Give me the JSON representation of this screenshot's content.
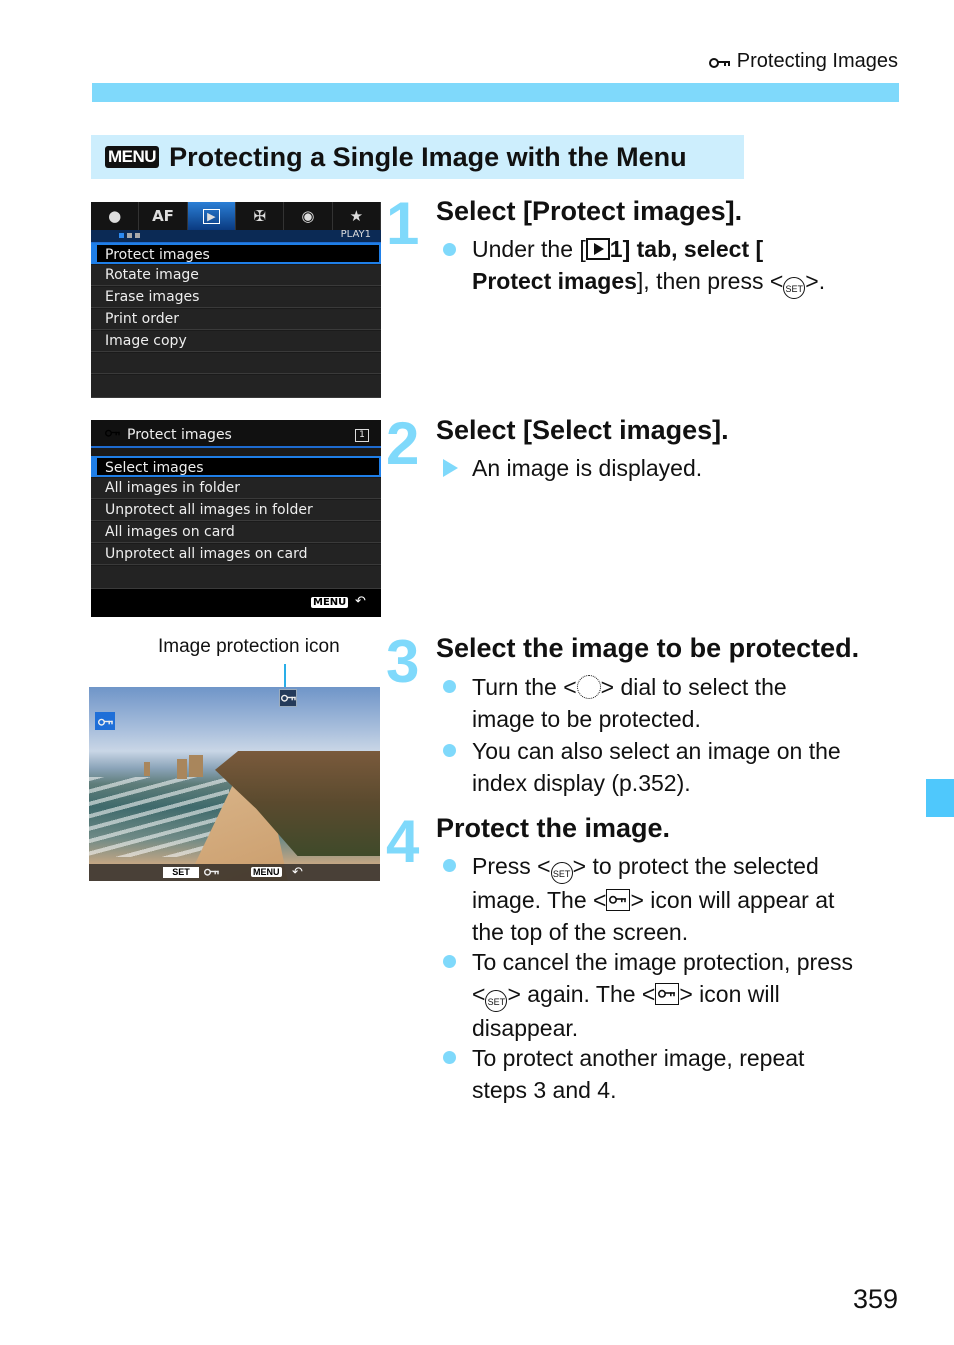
{
  "header": {
    "running_head": "Protecting Images",
    "running_head_icon": "key-icon",
    "accent_color": "#7fd9fb"
  },
  "section": {
    "badge": "MENU",
    "title": "Protecting a Single Image with the Menu"
  },
  "screen1": {
    "tabs": [
      "camera-icon",
      "AF",
      "play-icon",
      "wrench-icon",
      "custom-icon",
      "star-icon"
    ],
    "tab_af_label": "AF",
    "active_tab": "play",
    "page_label": "PLAY1",
    "items": [
      "Protect images",
      "Rotate image",
      "Erase images",
      "Print order",
      "Image copy"
    ],
    "selected_index": 0
  },
  "screen2": {
    "title": "Protect images",
    "card_label": "1",
    "items": [
      "Select images",
      "All images in folder",
      "Unprotect all images in folder",
      "All images on card",
      "Unprotect all images on card"
    ],
    "selected_index": 0,
    "footer_menu": "MENU"
  },
  "screen3": {
    "caption": "Image protection icon",
    "footer_set": "SET",
    "footer_menu": "MENU"
  },
  "steps": [
    {
      "number": "1",
      "title": "Select [Protect images].",
      "bullets": [
        {
          "type": "dot",
          "parts": [
            "Under the [",
            "1] tab, select [",
            "Protect images",
            "], then press <",
            ">."
          ]
        }
      ]
    },
    {
      "number": "2",
      "title": "Select [Select images].",
      "bullets": [
        {
          "type": "result",
          "text": "An image is displayed."
        }
      ]
    },
    {
      "number": "3",
      "title": "Select the image to be protected.",
      "bullets": [
        {
          "type": "dot",
          "parts": [
            "Turn the <",
            "> dial to select the",
            "image to be protected."
          ]
        },
        {
          "type": "dot",
          "parts": [
            "You can also select an image on the",
            "index display (p.352)."
          ]
        }
      ]
    },
    {
      "number": "4",
      "title": "Protect the image.",
      "bullets": [
        {
          "type": "dot",
          "parts": [
            "Press <",
            "> to protect the selected",
            "image. The <",
            "> icon will appear at",
            "the top of the screen."
          ]
        },
        {
          "type": "dot",
          "parts": [
            "To cancel the image protection, press",
            "<",
            "> again. The <",
            "> icon will",
            "disappear."
          ]
        },
        {
          "type": "dot",
          "parts": [
            "To protect another image, repeat",
            "steps 3 and 4."
          ]
        }
      ]
    }
  ],
  "footer": {
    "page_number": "359"
  }
}
